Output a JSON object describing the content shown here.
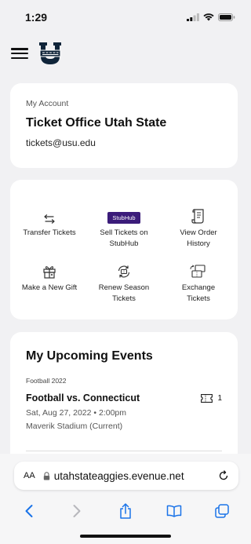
{
  "status": {
    "time": "1:29"
  },
  "header": {
    "logo_icon": "usu-state-u-logo",
    "brand_color": "#0f2439"
  },
  "account": {
    "label": "My Account",
    "name": "Ticket Office Utah State",
    "email": "tickets@usu.edu"
  },
  "actions": {
    "transfer": "Transfer Tickets",
    "sell_line1": "Sell Tickets on",
    "sell_line2": "StubHub",
    "stubhub_badge": "StubHub",
    "history_line1": "View Order",
    "history_line2": "History",
    "gift": "Make a New Gift",
    "renew_line1": "Renew Season",
    "renew_line2": "Tickets",
    "exchange_line1": "Exchange",
    "exchange_line2": "Tickets"
  },
  "events": {
    "title": "My Upcoming Events",
    "items": [
      {
        "season": "Football 2022",
        "name": "Football vs. Connecticut",
        "ticket_count": "1",
        "date": "Sat, Aug 27, 2022 • 2:00pm",
        "venue": "Maverik Stadium (Current)"
      }
    ]
  },
  "browser": {
    "aa_label": "AA",
    "url": "utahstateaggies.evenue.net",
    "accent_color": "#1a73e8"
  }
}
